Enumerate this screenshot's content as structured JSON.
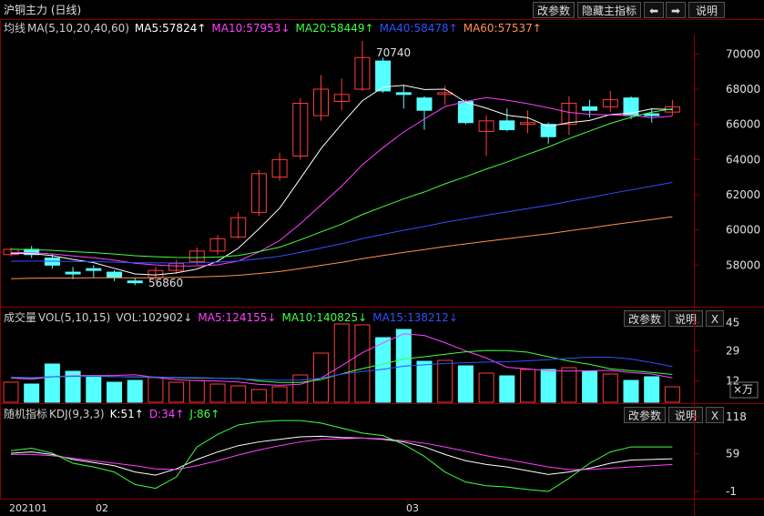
{
  "header": {
    "title": "沪铜主力 (日线)",
    "buttons": [
      "改参数",
      "隐藏主指标",
      "⬅",
      "➡",
      "说明"
    ]
  },
  "main_indicator": {
    "name": "均线",
    "params": "MA(5,10,20,40,60)",
    "ma5": "MA5:57824↑",
    "ma10": "MA10:57953↓",
    "ma20": "MA20:58449↑",
    "ma40": "MA40:58478↑",
    "ma60": "MA60:57537↑",
    "high_label": "70740",
    "low_label": "56860",
    "y_ticks": [
      "70000",
      "68000",
      "66000",
      "64000",
      "62000",
      "60000",
      "58000"
    ]
  },
  "volume_panel": {
    "name": "成交量",
    "params": "VOL(5,10,15)",
    "vol": "VOL:102902↓",
    "ma5": "MA5:124155↓",
    "ma10": "MA10:140825↓",
    "ma15": "MA15:138212↓",
    "buttons": [
      "改参数",
      "说明",
      "X"
    ],
    "y_ticks": [
      "45",
      "29",
      "12"
    ],
    "unit": "×万"
  },
  "kdj_panel": {
    "name": "随机指标",
    "params": "KDJ(9,3,3)",
    "k": "K:51↑",
    "d": "D:34↑",
    "j": "J:86↑",
    "buttons": [
      "改参数",
      "说明",
      "X"
    ],
    "y_ticks": [
      "118",
      "59",
      "-1"
    ]
  },
  "x_axis": {
    "labels": [
      "202101",
      "02",
      "03"
    ]
  },
  "colors": {
    "up": "#ff3c3c",
    "down": "#54ffff",
    "ma5": "#ffffff",
    "ma10": "#ff40ff",
    "ma20": "#40ff40",
    "ma40": "#3050ff",
    "ma60": "#ff9050",
    "frame": "#8b0000"
  },
  "chart_data": {
    "type": "candlestick",
    "candles": [
      {
        "o": 58600,
        "c": 58900,
        "h": 59000,
        "l": 58500
      },
      {
        "o": 58900,
        "c": 58600,
        "h": 59100,
        "l": 58400
      },
      {
        "o": 58400,
        "c": 58000,
        "h": 58600,
        "l": 57800
      },
      {
        "o": 57600,
        "c": 57500,
        "h": 57900,
        "l": 57200
      },
      {
        "o": 57800,
        "c": 57700,
        "h": 58000,
        "l": 57300
      },
      {
        "o": 57600,
        "c": 57300,
        "h": 57700,
        "l": 57100
      },
      {
        "o": 57100,
        "c": 57000,
        "h": 57300,
        "l": 56860
      },
      {
        "o": 57300,
        "c": 57700,
        "h": 57900,
        "l": 57100
      },
      {
        "o": 57700,
        "c": 58100,
        "h": 58300,
        "l": 57500
      },
      {
        "o": 58200,
        "c": 58800,
        "h": 59000,
        "l": 58000
      },
      {
        "o": 58800,
        "c": 59500,
        "h": 59700,
        "l": 58600
      },
      {
        "o": 59600,
        "c": 60700,
        "h": 61000,
        "l": 59500
      },
      {
        "o": 61000,
        "c": 63200,
        "h": 63400,
        "l": 60800
      },
      {
        "o": 63000,
        "c": 64000,
        "h": 64400,
        "l": 62800
      },
      {
        "o": 64200,
        "c": 67200,
        "h": 67500,
        "l": 64000
      },
      {
        "o": 66500,
        "c": 68000,
        "h": 68800,
        "l": 66200
      },
      {
        "o": 67300,
        "c": 67700,
        "h": 68600,
        "l": 66800
      },
      {
        "o": 68000,
        "c": 69800,
        "h": 70740,
        "l": 67900
      },
      {
        "o": 69600,
        "c": 67900,
        "h": 69800,
        "l": 67800
      },
      {
        "o": 67800,
        "c": 67700,
        "h": 68200,
        "l": 66900
      },
      {
        "o": 67500,
        "c": 66800,
        "h": 67600,
        "l": 65700
      },
      {
        "o": 67700,
        "c": 67800,
        "h": 68200,
        "l": 67100
      },
      {
        "o": 67300,
        "c": 66100,
        "h": 67400,
        "l": 66000
      },
      {
        "o": 65600,
        "c": 66200,
        "h": 66500,
        "l": 64200
      },
      {
        "o": 66200,
        "c": 65700,
        "h": 66900,
        "l": 65600
      },
      {
        "o": 66000,
        "c": 66100,
        "h": 66800,
        "l": 65500
      },
      {
        "o": 66000,
        "c": 65300,
        "h": 66100,
        "l": 64900
      },
      {
        "o": 66000,
        "c": 67200,
        "h": 67600,
        "l": 65400
      },
      {
        "o": 67000,
        "c": 66800,
        "h": 67400,
        "l": 66400
      },
      {
        "o": 67000,
        "c": 67400,
        "h": 67900,
        "l": 66700
      },
      {
        "o": 67500,
        "c": 66500,
        "h": 67600,
        "l": 66300
      },
      {
        "o": 66600,
        "c": 66500,
        "h": 66900,
        "l": 66100
      },
      {
        "o": 66700,
        "c": 67000,
        "h": 67400,
        "l": 66500
      }
    ],
    "volume": [
      22,
      20,
      42,
      34,
      29,
      22,
      24,
      27,
      22,
      24,
      20,
      18,
      14,
      17,
      30,
      54,
      86,
      85,
      71,
      80,
      45,
      46,
      40,
      32,
      29,
      36,
      36,
      38,
      34,
      31,
      24,
      28,
      17
    ],
    "kdj": {
      "k": [
        60,
        62,
        58,
        50,
        45,
        40,
        30,
        25,
        35,
        50,
        62,
        72,
        78,
        82,
        86,
        87,
        85,
        84,
        82,
        78,
        70,
        58,
        48,
        42,
        38,
        32,
        26,
        30,
        36,
        44,
        49,
        50,
        51
      ],
      "d": [
        58,
        58,
        56,
        52,
        48,
        44,
        40,
        35,
        34,
        40,
        48,
        57,
        65,
        72,
        78,
        82,
        83,
        84,
        83,
        80,
        76,
        70,
        63,
        56,
        50,
        44,
        38,
        34,
        34,
        36,
        38,
        40,
        42
      ],
      "j": [
        64,
        68,
        60,
        44,
        38,
        30,
        10,
        4,
        22,
        70,
        90,
        105,
        110,
        112,
        112,
        108,
        100,
        92,
        88,
        74,
        55,
        30,
        14,
        8,
        6,
        2,
        -1,
        20,
        44,
        62,
        70,
        70,
        70
      ]
    },
    "ylim": [
      56000,
      71000
    ]
  }
}
